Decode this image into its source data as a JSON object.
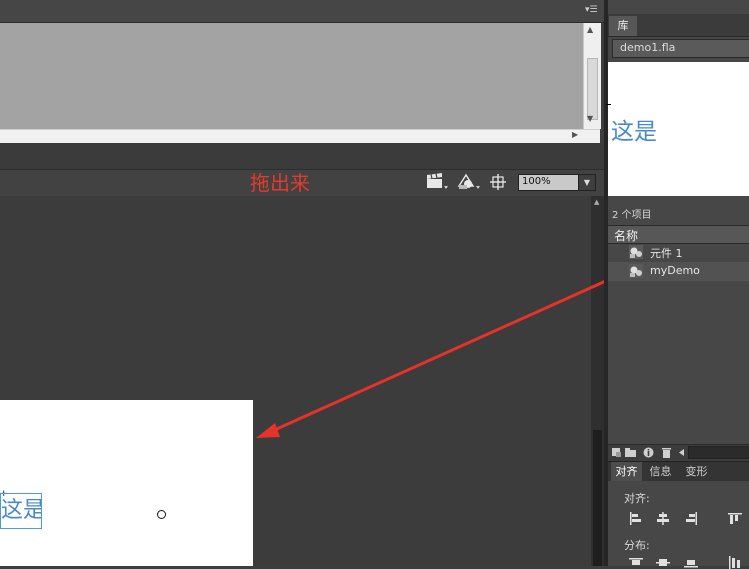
{
  "timeline": {
    "panel_menu_glyph": "▾☰"
  },
  "stage_toolbar": {
    "annotation_text": "拖出来",
    "annotation_color": "#e33a2e",
    "edit_scene_icon": "clapperboard-icon",
    "edit_symbols_icon": "symbol-icon",
    "center_stage_icon": "crosshair-icon",
    "zoom_value": "100%"
  },
  "stage": {
    "text_object": "这是",
    "text_color": "#4a89c9"
  },
  "library": {
    "tab_label": "库",
    "document_select": "demo1.fla",
    "preview_text": "这是",
    "item_count": "2 个项目",
    "column_name": "名称",
    "items": [
      {
        "label": "元件 1",
        "icon": "movieclip-symbol-icon"
      },
      {
        "label": "myDemo",
        "icon": "movieclip-symbol-icon"
      }
    ],
    "bottom_buttons": [
      "new-symbol-icon",
      "new-folder-icon",
      "properties-icon",
      "delete-icon"
    ]
  },
  "align_panel": {
    "tabs": [
      "对齐",
      "信息",
      "变形"
    ],
    "align_label": "对齐:",
    "distribute_label": "分布:"
  }
}
